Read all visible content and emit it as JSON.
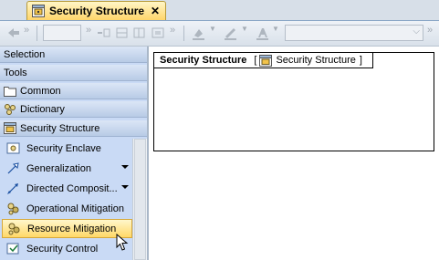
{
  "tab": {
    "title": "Security Structure",
    "close": "✕"
  },
  "toolbar": {
    "more1": "»",
    "more2": "»",
    "more3": "»",
    "more4": "»"
  },
  "palette": {
    "sections": [
      {
        "label": "Selection"
      },
      {
        "label": "Tools"
      },
      {
        "label": "Common"
      },
      {
        "label": "Dictionary"
      },
      {
        "label": "Security Structure"
      }
    ],
    "tools": [
      {
        "label": "Security Enclave"
      },
      {
        "label": "Generalization"
      },
      {
        "label": "Directed Composit..."
      },
      {
        "label": "Operational Mitigation"
      },
      {
        "label": "Resource Mitigation"
      },
      {
        "label": "Security Control"
      }
    ]
  },
  "diagram": {
    "title": "Security Structure",
    "bracket_open": "[",
    "type": "Security Structure",
    "bracket_close": "]"
  },
  "colors": {
    "selected_fill": "#ffd867",
    "palette_bg": "#c9daf5",
    "tab_fill": "#ffd56a"
  }
}
